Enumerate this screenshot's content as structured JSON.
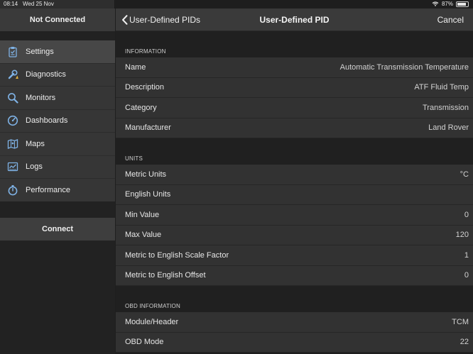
{
  "status_bar": {
    "time": "08:14",
    "date": "Wed 25 Nov",
    "battery": "87%",
    "battery_fraction": 0.87
  },
  "sidebar": {
    "title": "Not Connected",
    "items": [
      {
        "label": "Settings",
        "icon": "clipboard-icon",
        "active": true
      },
      {
        "label": "Diagnostics",
        "icon": "wrench-icon",
        "active": false
      },
      {
        "label": "Monitors",
        "icon": "magnifier-icon",
        "active": false
      },
      {
        "label": "Dashboards",
        "icon": "gauge-icon",
        "active": false
      },
      {
        "label": "Maps",
        "icon": "map-icon",
        "active": false
      },
      {
        "label": "Logs",
        "icon": "chart-icon",
        "active": false
      },
      {
        "label": "Performance",
        "icon": "stopwatch-icon",
        "active": false
      }
    ],
    "connect_label": "Connect"
  },
  "navbar": {
    "back_label": "User-Defined PIDs",
    "title": "User-Defined PID",
    "cancel_label": "Cancel"
  },
  "sections": {
    "information": {
      "header": "INFORMATION",
      "rows": [
        {
          "label": "Name",
          "value": "Automatic Transmission Temperature"
        },
        {
          "label": "Description",
          "value": "ATF Fluid Temp"
        },
        {
          "label": "Category",
          "value": "Transmission"
        },
        {
          "label": "Manufacturer",
          "value": "Land Rover"
        }
      ]
    },
    "units": {
      "header": "UNITS",
      "rows": [
        {
          "label": "Metric Units",
          "value": "°C"
        },
        {
          "label": "English Units",
          "value": ""
        },
        {
          "label": "Min Value",
          "value": "0"
        },
        {
          "label": "Max Value",
          "value": "120"
        },
        {
          "label": "Metric to English Scale Factor",
          "value": "1"
        },
        {
          "label": "Metric to English Offset",
          "value": "0"
        }
      ]
    },
    "obd": {
      "header": "OBD INFORMATION",
      "rows": [
        {
          "label": "Module/Header",
          "value": "TCM"
        },
        {
          "label": "OBD Mode",
          "value": "22"
        }
      ]
    }
  },
  "colors": {
    "icon_blue": "#7fb2e5",
    "background": "#1e1e1e",
    "row": "#323232"
  }
}
